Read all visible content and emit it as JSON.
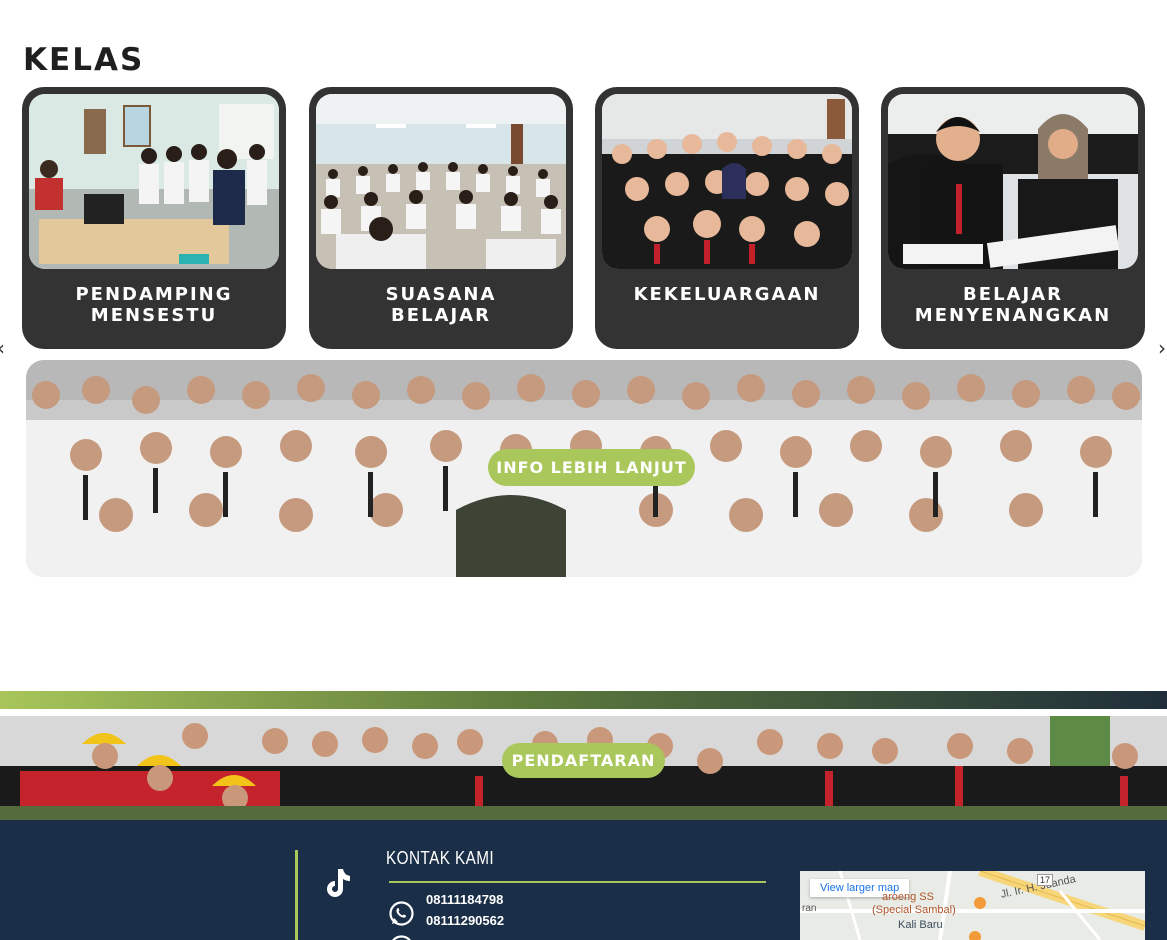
{
  "section": {
    "title": "KELAS"
  },
  "carousel": {
    "prev_icon": "‹",
    "next_icon": "›",
    "cards": [
      {
        "label": "PENDAMPING\nMENSESTU",
        "photo": "classroom-computer-photo"
      },
      {
        "label": "SUASANA\nBELAJAR",
        "photo": "exam-hall-photo"
      },
      {
        "label": "KEKELUARGAAN",
        "photo": "group-selfie-photo"
      },
      {
        "label": "BELAJAR\nMENYENANGKAN",
        "photo": "study-together-photo"
      }
    ]
  },
  "banner": {
    "button_label": "INFO LEBIH LANJUT"
  },
  "registration": {
    "button_label": "PENDAFTARAN"
  },
  "footer": {
    "contact_heading": "KONTAK KAMI",
    "phones": [
      "08111184798",
      "08111290562"
    ],
    "map": {
      "link_label": "View larger map",
      "place_name": "aroeng SS",
      "place_sub": "(Special Sambal)",
      "area": "Kali Baru",
      "road": "Jl. Ir. H. Juanda",
      "road_number": "17",
      "small_road": "ran"
    }
  },
  "colors": {
    "accent_green": "#a9c75a",
    "card_dark": "#333333",
    "footer_navy": "#1b2e47",
    "olive": "#566b3c"
  }
}
